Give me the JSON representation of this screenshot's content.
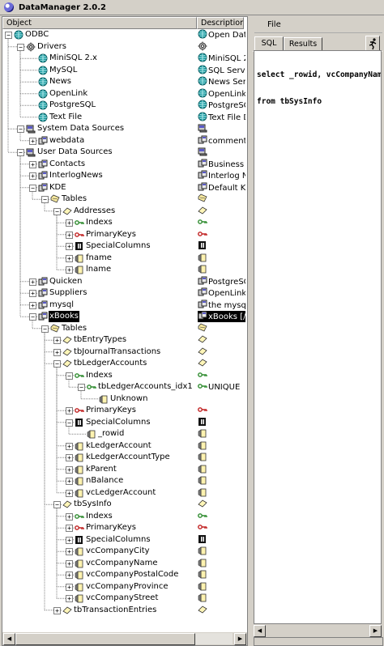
{
  "window": {
    "title": "DataManager 2.0.2"
  },
  "tree": {
    "columns": [
      "Object",
      "Description"
    ],
    "rows": [
      {
        "name": "ODBC",
        "indent": 0,
        "toggle": "-",
        "icon": "globe",
        "desc": "Open Data",
        "dicon": "globe"
      },
      {
        "name": "Drivers",
        "indent": 1,
        "toggle": "-",
        "icon": "gear",
        "desc": "",
        "dicon": "gear"
      },
      {
        "name": "MiniSQL 2.x",
        "indent": 2,
        "toggle": "",
        "icon": "globe",
        "desc": "MiniSQL 2",
        "dicon": "globe"
      },
      {
        "name": "MySQL",
        "indent": 2,
        "toggle": "",
        "icon": "globe",
        "desc": "SQL Serve",
        "dicon": "globe"
      },
      {
        "name": "News",
        "indent": 2,
        "toggle": "",
        "icon": "globe",
        "desc": "News Serv",
        "dicon": "globe"
      },
      {
        "name": "OpenLink",
        "indent": 2,
        "toggle": "",
        "icon": "globe",
        "desc": "OpenLink",
        "dicon": "globe"
      },
      {
        "name": "PostgreSQL",
        "indent": 2,
        "toggle": "",
        "icon": "globe",
        "desc": "PostgreSQ",
        "dicon": "globe"
      },
      {
        "name": "Text File",
        "indent": 2,
        "toggle": "",
        "icon": "globe",
        "desc": "Text File D",
        "dicon": "globe"
      },
      {
        "name": "System Data Sources",
        "indent": 1,
        "toggle": "-",
        "icon": "server",
        "desc": "",
        "dicon": "server"
      },
      {
        "name": "webdata",
        "indent": 2,
        "toggle": "+",
        "icon": "db",
        "desc": "comment1",
        "dicon": "db"
      },
      {
        "name": "User Data Sources",
        "indent": 1,
        "toggle": "-",
        "icon": "server",
        "desc": "",
        "dicon": "server"
      },
      {
        "name": "Contacts",
        "indent": 2,
        "toggle": "+",
        "icon": "db",
        "desc": "Business c",
        "dicon": "db"
      },
      {
        "name": "InterlogNews",
        "indent": 2,
        "toggle": "+",
        "icon": "db",
        "desc": "Interlog Ne",
        "dicon": "db"
      },
      {
        "name": "KDE",
        "indent": 2,
        "toggle": "-",
        "icon": "db",
        "desc": "Default KD",
        "dicon": "db"
      },
      {
        "name": "Tables",
        "indent": 3,
        "toggle": "-",
        "icon": "folder",
        "desc": "",
        "dicon": "folder"
      },
      {
        "name": "Addresses",
        "indent": 4,
        "toggle": "-",
        "icon": "table",
        "desc": "",
        "dicon": "table"
      },
      {
        "name": "Indexs",
        "indent": 5,
        "toggle": "+",
        "icon": "key-green",
        "desc": "",
        "dicon": "key-green"
      },
      {
        "name": "PrimaryKeys",
        "indent": 5,
        "toggle": "+",
        "icon": "key-red",
        "desc": "",
        "dicon": "key-red"
      },
      {
        "name": "SpecialColumns",
        "indent": 5,
        "toggle": "+",
        "icon": "special",
        "desc": "",
        "dicon": "special"
      },
      {
        "name": "fname",
        "indent": 5,
        "toggle": "+",
        "icon": "column",
        "desc": "",
        "dicon": "column"
      },
      {
        "name": "lname",
        "indent": 5,
        "toggle": "+",
        "icon": "column",
        "desc": "",
        "dicon": "column"
      },
      {
        "name": "Quicken",
        "indent": 2,
        "toggle": "+",
        "icon": "db",
        "desc": "PostgreSQ",
        "dicon": "db"
      },
      {
        "name": "Suppliers",
        "indent": 2,
        "toggle": "+",
        "icon": "db",
        "desc": "OpenLink",
        "dicon": "db"
      },
      {
        "name": "mysql",
        "indent": 2,
        "toggle": "+",
        "icon": "db",
        "desc": "the mysql",
        "dicon": "db"
      },
      {
        "name": "xBooks",
        "indent": 2,
        "toggle": "-",
        "icon": "db",
        "desc": "xBooks [/u",
        "dicon": "db",
        "selected": true
      },
      {
        "name": "Tables",
        "indent": 3,
        "toggle": "-",
        "icon": "folder",
        "desc": "",
        "dicon": "folder"
      },
      {
        "name": "tbEntryTypes",
        "indent": 4,
        "toggle": "+",
        "icon": "table",
        "desc": "",
        "dicon": "table"
      },
      {
        "name": "tbJournalTransactions",
        "indent": 4,
        "toggle": "+",
        "icon": "table",
        "desc": "",
        "dicon": "table"
      },
      {
        "name": "tbLedgerAccounts",
        "indent": 4,
        "toggle": "-",
        "icon": "table",
        "desc": "",
        "dicon": "table"
      },
      {
        "name": "Indexs",
        "indent": 5,
        "toggle": "-",
        "icon": "key-green",
        "desc": "",
        "dicon": "key-green"
      },
      {
        "name": "tbLedgerAccounts_idx1",
        "indent": 6,
        "toggle": "-",
        "icon": "key-green",
        "desc": "UNIQUE",
        "dicon": "key-green"
      },
      {
        "name": "Unknown",
        "indent": 7,
        "toggle": "",
        "icon": "column",
        "desc": "",
        "dicon": ""
      },
      {
        "name": "PrimaryKeys",
        "indent": 5,
        "toggle": "+",
        "icon": "key-red",
        "desc": "",
        "dicon": "key-red"
      },
      {
        "name": "SpecialColumns",
        "indent": 5,
        "toggle": "-",
        "icon": "special",
        "desc": "",
        "dicon": "special"
      },
      {
        "name": "_rowid",
        "indent": 6,
        "toggle": "",
        "icon": "column",
        "desc": "",
        "dicon": "column"
      },
      {
        "name": "kLedgerAccount",
        "indent": 5,
        "toggle": "+",
        "icon": "column",
        "desc": "",
        "dicon": "column"
      },
      {
        "name": "kLedgerAccountType",
        "indent": 5,
        "toggle": "+",
        "icon": "column",
        "desc": "",
        "dicon": "column"
      },
      {
        "name": "kParent",
        "indent": 5,
        "toggle": "+",
        "icon": "column",
        "desc": "",
        "dicon": "column"
      },
      {
        "name": "nBalance",
        "indent": 5,
        "toggle": "+",
        "icon": "column",
        "desc": "",
        "dicon": "column"
      },
      {
        "name": "vcLedgerAccount",
        "indent": 5,
        "toggle": "+",
        "icon": "column",
        "desc": "",
        "dicon": "column"
      },
      {
        "name": "tbSysInfo",
        "indent": 4,
        "toggle": "-",
        "icon": "table",
        "desc": "",
        "dicon": "table"
      },
      {
        "name": "Indexs",
        "indent": 5,
        "toggle": "+",
        "icon": "key-green",
        "desc": "",
        "dicon": "key-green"
      },
      {
        "name": "PrimaryKeys",
        "indent": 5,
        "toggle": "+",
        "icon": "key-red",
        "desc": "",
        "dicon": "key-red"
      },
      {
        "name": "SpecialColumns",
        "indent": 5,
        "toggle": "+",
        "icon": "special",
        "desc": "",
        "dicon": "special"
      },
      {
        "name": "vcCompanyCity",
        "indent": 5,
        "toggle": "+",
        "icon": "column",
        "desc": "",
        "dicon": "column"
      },
      {
        "name": "vcCompanyName",
        "indent": 5,
        "toggle": "+",
        "icon": "column",
        "desc": "",
        "dicon": "column"
      },
      {
        "name": "vcCompanyPostalCode",
        "indent": 5,
        "toggle": "+",
        "icon": "column",
        "desc": "",
        "dicon": "column"
      },
      {
        "name": "vcCompanyProvince",
        "indent": 5,
        "toggle": "+",
        "icon": "column",
        "desc": "",
        "dicon": "column"
      },
      {
        "name": "vcCompanyStreet",
        "indent": 5,
        "toggle": "+",
        "icon": "column",
        "desc": "",
        "dicon": "column"
      },
      {
        "name": "tbTransactionEntries",
        "indent": 4,
        "toggle": "+",
        "icon": "table",
        "desc": "",
        "dicon": "table"
      }
    ]
  },
  "right": {
    "menu": {
      "file": "File"
    },
    "tabs": [
      "SQL",
      "Results"
    ],
    "active_tab": 0,
    "sql_lines": [
      "select _rowid, vcCompanyName",
      "from tbSysInfo"
    ]
  },
  "colors": {
    "selection": "#000000",
    "globe": "#1a9aa0",
    "key_green": "#2e8b2e",
    "key_red": "#c02020"
  }
}
